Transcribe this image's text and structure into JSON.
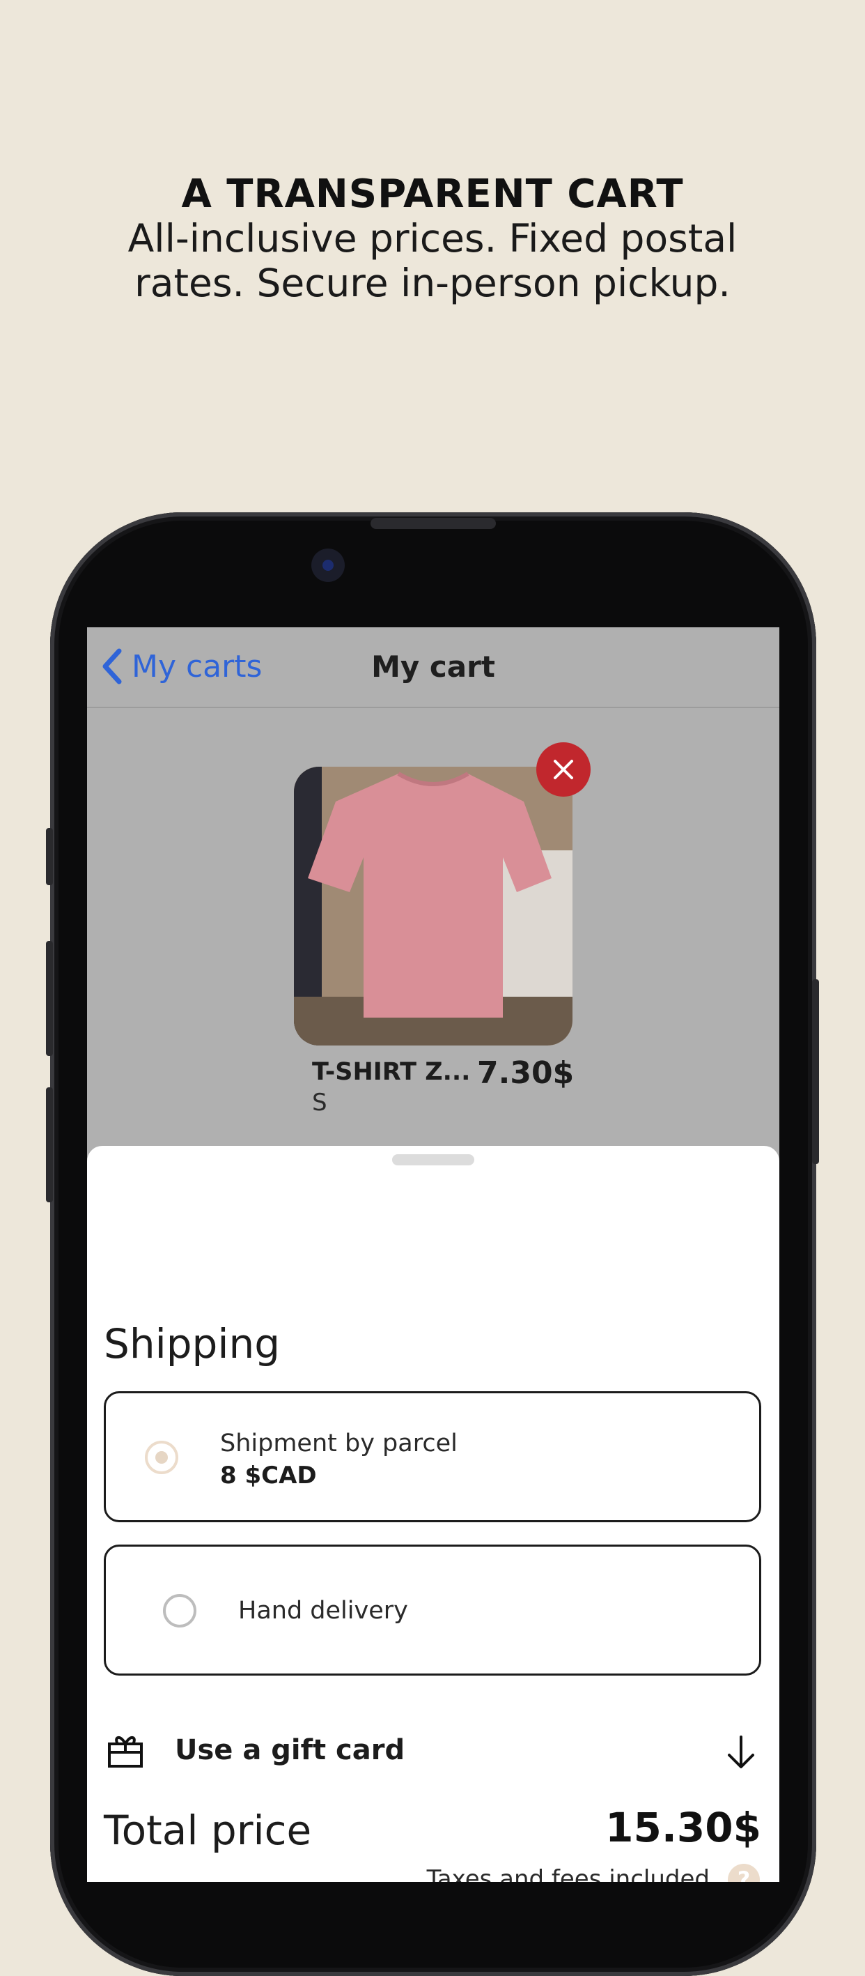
{
  "promo": {
    "title": "A TRANSPARENT CART",
    "subtitle_line1": "All-inclusive prices. Fixed postal",
    "subtitle_line2": "rates. Secure in-person pickup."
  },
  "navbar": {
    "back_label": "My carts",
    "title": "My cart"
  },
  "product": {
    "name": "T-SHIRT Z...",
    "size": "S",
    "price": "7.30$"
  },
  "shipping": {
    "title": "Shipping",
    "options": [
      {
        "label": "Shipment by parcel",
        "price": "8 $CAD",
        "selected": true
      },
      {
        "label": "Hand delivery",
        "selected": false
      }
    ]
  },
  "gift_card": {
    "label": "Use a gift card"
  },
  "total": {
    "label": "Total price",
    "value": "15.30$",
    "note": "Taxes and fees included",
    "help_symbol": "?"
  },
  "colors": {
    "background": "#ede7da",
    "accent_link": "#2f64d8",
    "remove_red": "#c1272d",
    "radio_beige": "#ecdccb"
  },
  "icons": [
    "chevron-left-icon",
    "close-icon",
    "gift-icon",
    "arrow-down-icon",
    "help-icon"
  ]
}
